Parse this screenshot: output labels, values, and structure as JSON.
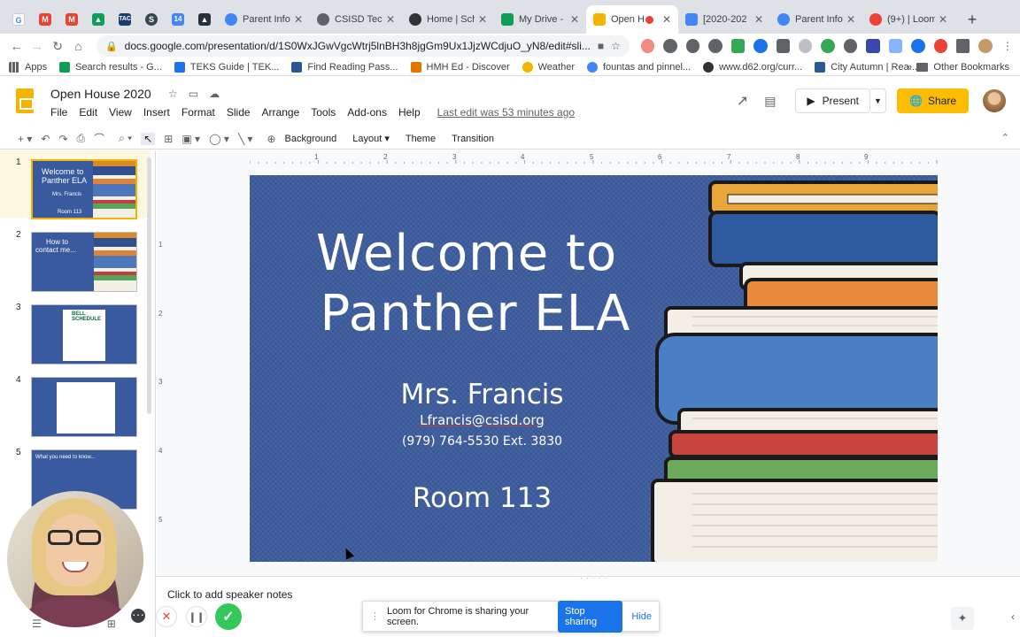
{
  "browser": {
    "tabs": [
      {
        "title": "Parent Info",
        "favicon_color": "#4285f4"
      },
      {
        "title": "CSISD Tech",
        "favicon_color": "#5f6368"
      },
      {
        "title": "Home | Sch",
        "favicon_color": "#333333"
      },
      {
        "title": "My Drive -",
        "favicon_color": "#0f9d58"
      },
      {
        "title": "Open H",
        "favicon_color": "#f4b400",
        "active": true
      },
      {
        "title": "[2020-202",
        "favicon_color": "#4285f4"
      },
      {
        "title": "Parent Info",
        "favicon_color": "#4285f4"
      },
      {
        "title": "(9+) | Loom",
        "favicon_color": "#ea4335"
      }
    ],
    "url": "docs.google.com/presentation/d/1S0WxJGwVgcWtrj5lnBH3h8jgGm9Ux1JjzWCdjuO_yN8/edit#sli...",
    "bookmarks": [
      {
        "label": "Apps",
        "color": "#5f6368"
      },
      {
        "label": "Search results - G...",
        "color": "#0f9d58"
      },
      {
        "label": "TEKS Guide | TEK...",
        "color": "#1a73e8"
      },
      {
        "label": "Find Reading Pass...",
        "color": "#2b5797"
      },
      {
        "label": "HMH Ed - Discover",
        "color": "#e37400"
      },
      {
        "label": "Weather",
        "color": "#f4b400"
      },
      {
        "label": "fountas and pinnel...",
        "color": "#4285f4"
      },
      {
        "label": "www.d62.org/curr...",
        "color": "#333333"
      },
      {
        "label": "City Autumn | Rea...",
        "color": "#2b5797"
      }
    ],
    "other_bookmarks": "Other Bookmarks",
    "more_bookmarks": "»"
  },
  "docs": {
    "title": "Open House 2020",
    "menu": [
      "File",
      "Edit",
      "View",
      "Insert",
      "Format",
      "Slide",
      "Arrange",
      "Tools",
      "Add-ons",
      "Help"
    ],
    "last_edit": "Last edit was 53 minutes ago",
    "present_label": "Present",
    "share_label": "Share",
    "toolbar_text": {
      "background": "Background",
      "layout": "Layout",
      "theme": "Theme",
      "transition": "Transition"
    }
  },
  "filmstrip": {
    "slides": [
      {
        "num": "1",
        "lines": [
          "Welcome to",
          "Panther ELA",
          "Mrs. Francis",
          "Room 113"
        ]
      },
      {
        "num": "2",
        "lines": [
          "How to",
          "contact me..."
        ]
      },
      {
        "num": "3",
        "lines": [
          "BELL",
          "SCHEDULE"
        ]
      },
      {
        "num": "4",
        "lines": []
      },
      {
        "num": "5",
        "lines": [
          "What you need to know..."
        ]
      }
    ]
  },
  "ruler": {
    "h": [
      "1",
      "1",
      "2",
      "3",
      "4",
      "5",
      "6",
      "7",
      "8",
      "9"
    ],
    "v": [
      "1",
      "2",
      "3",
      "4",
      "5"
    ]
  },
  "slide": {
    "title_line1": "Welcome to",
    "title_line2": "Panther ELA",
    "teacher": "Mrs. Francis",
    "email": "Lfrancis@csisd.org",
    "phone": "(979) 764-5530 Ext. 3830",
    "room": "Room 113"
  },
  "notes_placeholder": "Click to add speaker notes",
  "loom": {
    "message": "Loom for Chrome is sharing your screen.",
    "stop_label": "Stop sharing",
    "hide_label": "Hide"
  },
  "colors": {
    "slide_bg": "#3c5c9e",
    "share_button": "#fbbc04",
    "stop_button": "#1a73e8"
  }
}
